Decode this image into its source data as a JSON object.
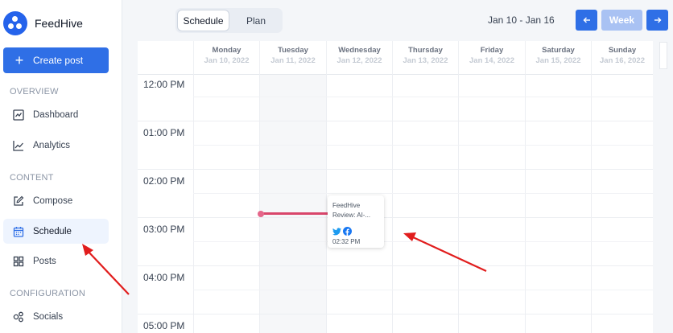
{
  "brand": {
    "name": "FeedHive"
  },
  "sidebar": {
    "create_label": "Create post",
    "sections": {
      "overview": "OVERVIEW",
      "content": "CONTENT",
      "configuration": "CONFIGURATION"
    },
    "items": [
      {
        "label": "Dashboard",
        "icon": "dashboard-icon"
      },
      {
        "label": "Analytics",
        "icon": "analytics-icon"
      },
      {
        "label": "Compose",
        "icon": "compose-icon"
      },
      {
        "label": "Schedule",
        "icon": "calendar-icon",
        "active": true
      },
      {
        "label": "Posts",
        "icon": "grid-icon"
      },
      {
        "label": "Socials",
        "icon": "socials-icon"
      }
    ]
  },
  "toolbar": {
    "view_options": [
      "Schedule",
      "Plan"
    ],
    "selected_view": "Schedule",
    "date_range": "Jan 10 - Jan 16",
    "prev_icon": "arrow-left-icon",
    "week_label": "Week",
    "next_icon": "arrow-right-icon"
  },
  "calendar": {
    "days": [
      {
        "name": "Monday",
        "date": "Jan 10, 2022"
      },
      {
        "name": "Tuesday",
        "date": "Jan 11, 2022"
      },
      {
        "name": "Wednesday",
        "date": "Jan 12, 2022"
      },
      {
        "name": "Thursday",
        "date": "Jan 13, 2022"
      },
      {
        "name": "Friday",
        "date": "Jan 14, 2022"
      },
      {
        "name": "Saturday",
        "date": "Jan 15, 2022"
      },
      {
        "name": "Sunday",
        "date": "Jan 16, 2022"
      }
    ],
    "times": [
      "12:00 PM",
      "01:00 PM",
      "02:00 PM",
      "03:00 PM",
      "04:00 PM",
      "05:00 PM"
    ]
  },
  "post": {
    "title_line1": "FeedHive",
    "title_line2": "Review: AI-...",
    "networks": [
      "twitter-icon",
      "facebook-icon"
    ],
    "time": "02:32 PM"
  },
  "colors": {
    "accent": "#2f6fe6",
    "accent_light": "#a9c2f3",
    "now_line": "#d9466b",
    "annotation": "#e11d1d"
  }
}
